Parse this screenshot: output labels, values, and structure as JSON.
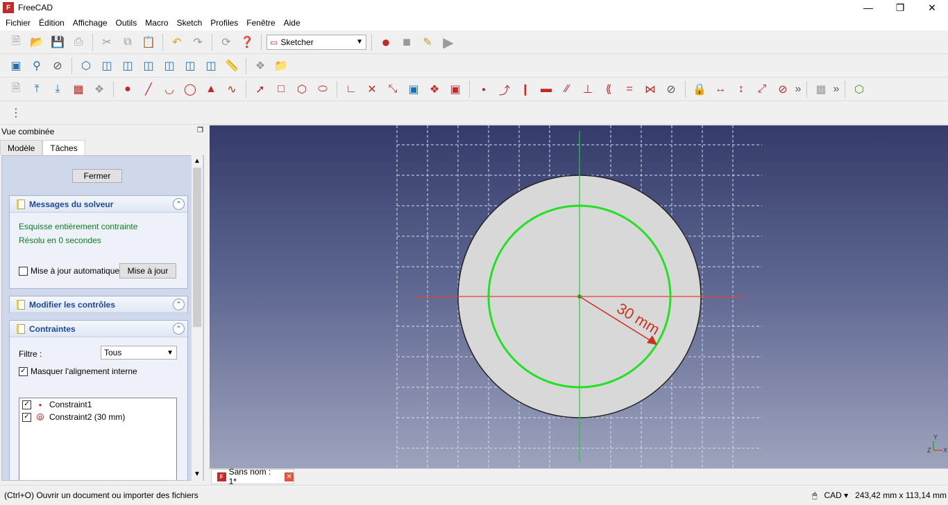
{
  "window": {
    "title": "FreeCAD",
    "app_icon": "freecad-icon",
    "controls": [
      "minimize-icon",
      "restore-icon",
      "close-icon"
    ]
  },
  "menu": [
    "Fichier",
    "Édition",
    "Affichage",
    "Outils",
    "Macro",
    "Sketch",
    "Profiles",
    "Fenêtre",
    "Aide"
  ],
  "workbench": {
    "selected": "Sketcher"
  },
  "combo_view": {
    "title": "Vue combinée",
    "tabs": [
      "Modèle",
      "Tâches"
    ],
    "active_tab": "Tâches",
    "close_button": "Fermer",
    "solver": {
      "title": "Messages du solveur",
      "status": "Esquisse entièrement contrainte",
      "time": "Résolu en 0 secondes",
      "auto_update_label": "Mise à jour automatique",
      "auto_update_checked": false,
      "update_button": "Mise à jour"
    },
    "edit_controls": {
      "title": "Modifier les contrôles"
    },
    "constraints": {
      "title": "Contraintes",
      "filter_label": "Filtre :",
      "filter_value": "Tous",
      "hide_internal_label": "Masquer l'alignement interne",
      "hide_internal_checked": true,
      "items": [
        {
          "name": "Constraint1",
          "icon": "coincident-point-icon",
          "checked": true
        },
        {
          "name": "Constraint2 (30 mm)",
          "icon": "radius-constraint-icon",
          "checked": true
        }
      ]
    }
  },
  "viewport": {
    "dimension_label": "30 mm",
    "axis_labels": {
      "y": "Y",
      "z": "Z",
      "x": "X"
    },
    "colors": {
      "circle": "#22e022",
      "x_axis": "#e0442a",
      "y_axis": "#22cc33",
      "dimension": "#c8341d",
      "disc": "#d8d8d8"
    }
  },
  "document_tab": {
    "label": "Sans nom : 1*"
  },
  "status_bar": {
    "message": "(Ctrl+O) Ouvrir un document ou importer des fichiers",
    "nav_style": "CAD",
    "dimensions": "243,42 mm x 113,14 mm"
  }
}
